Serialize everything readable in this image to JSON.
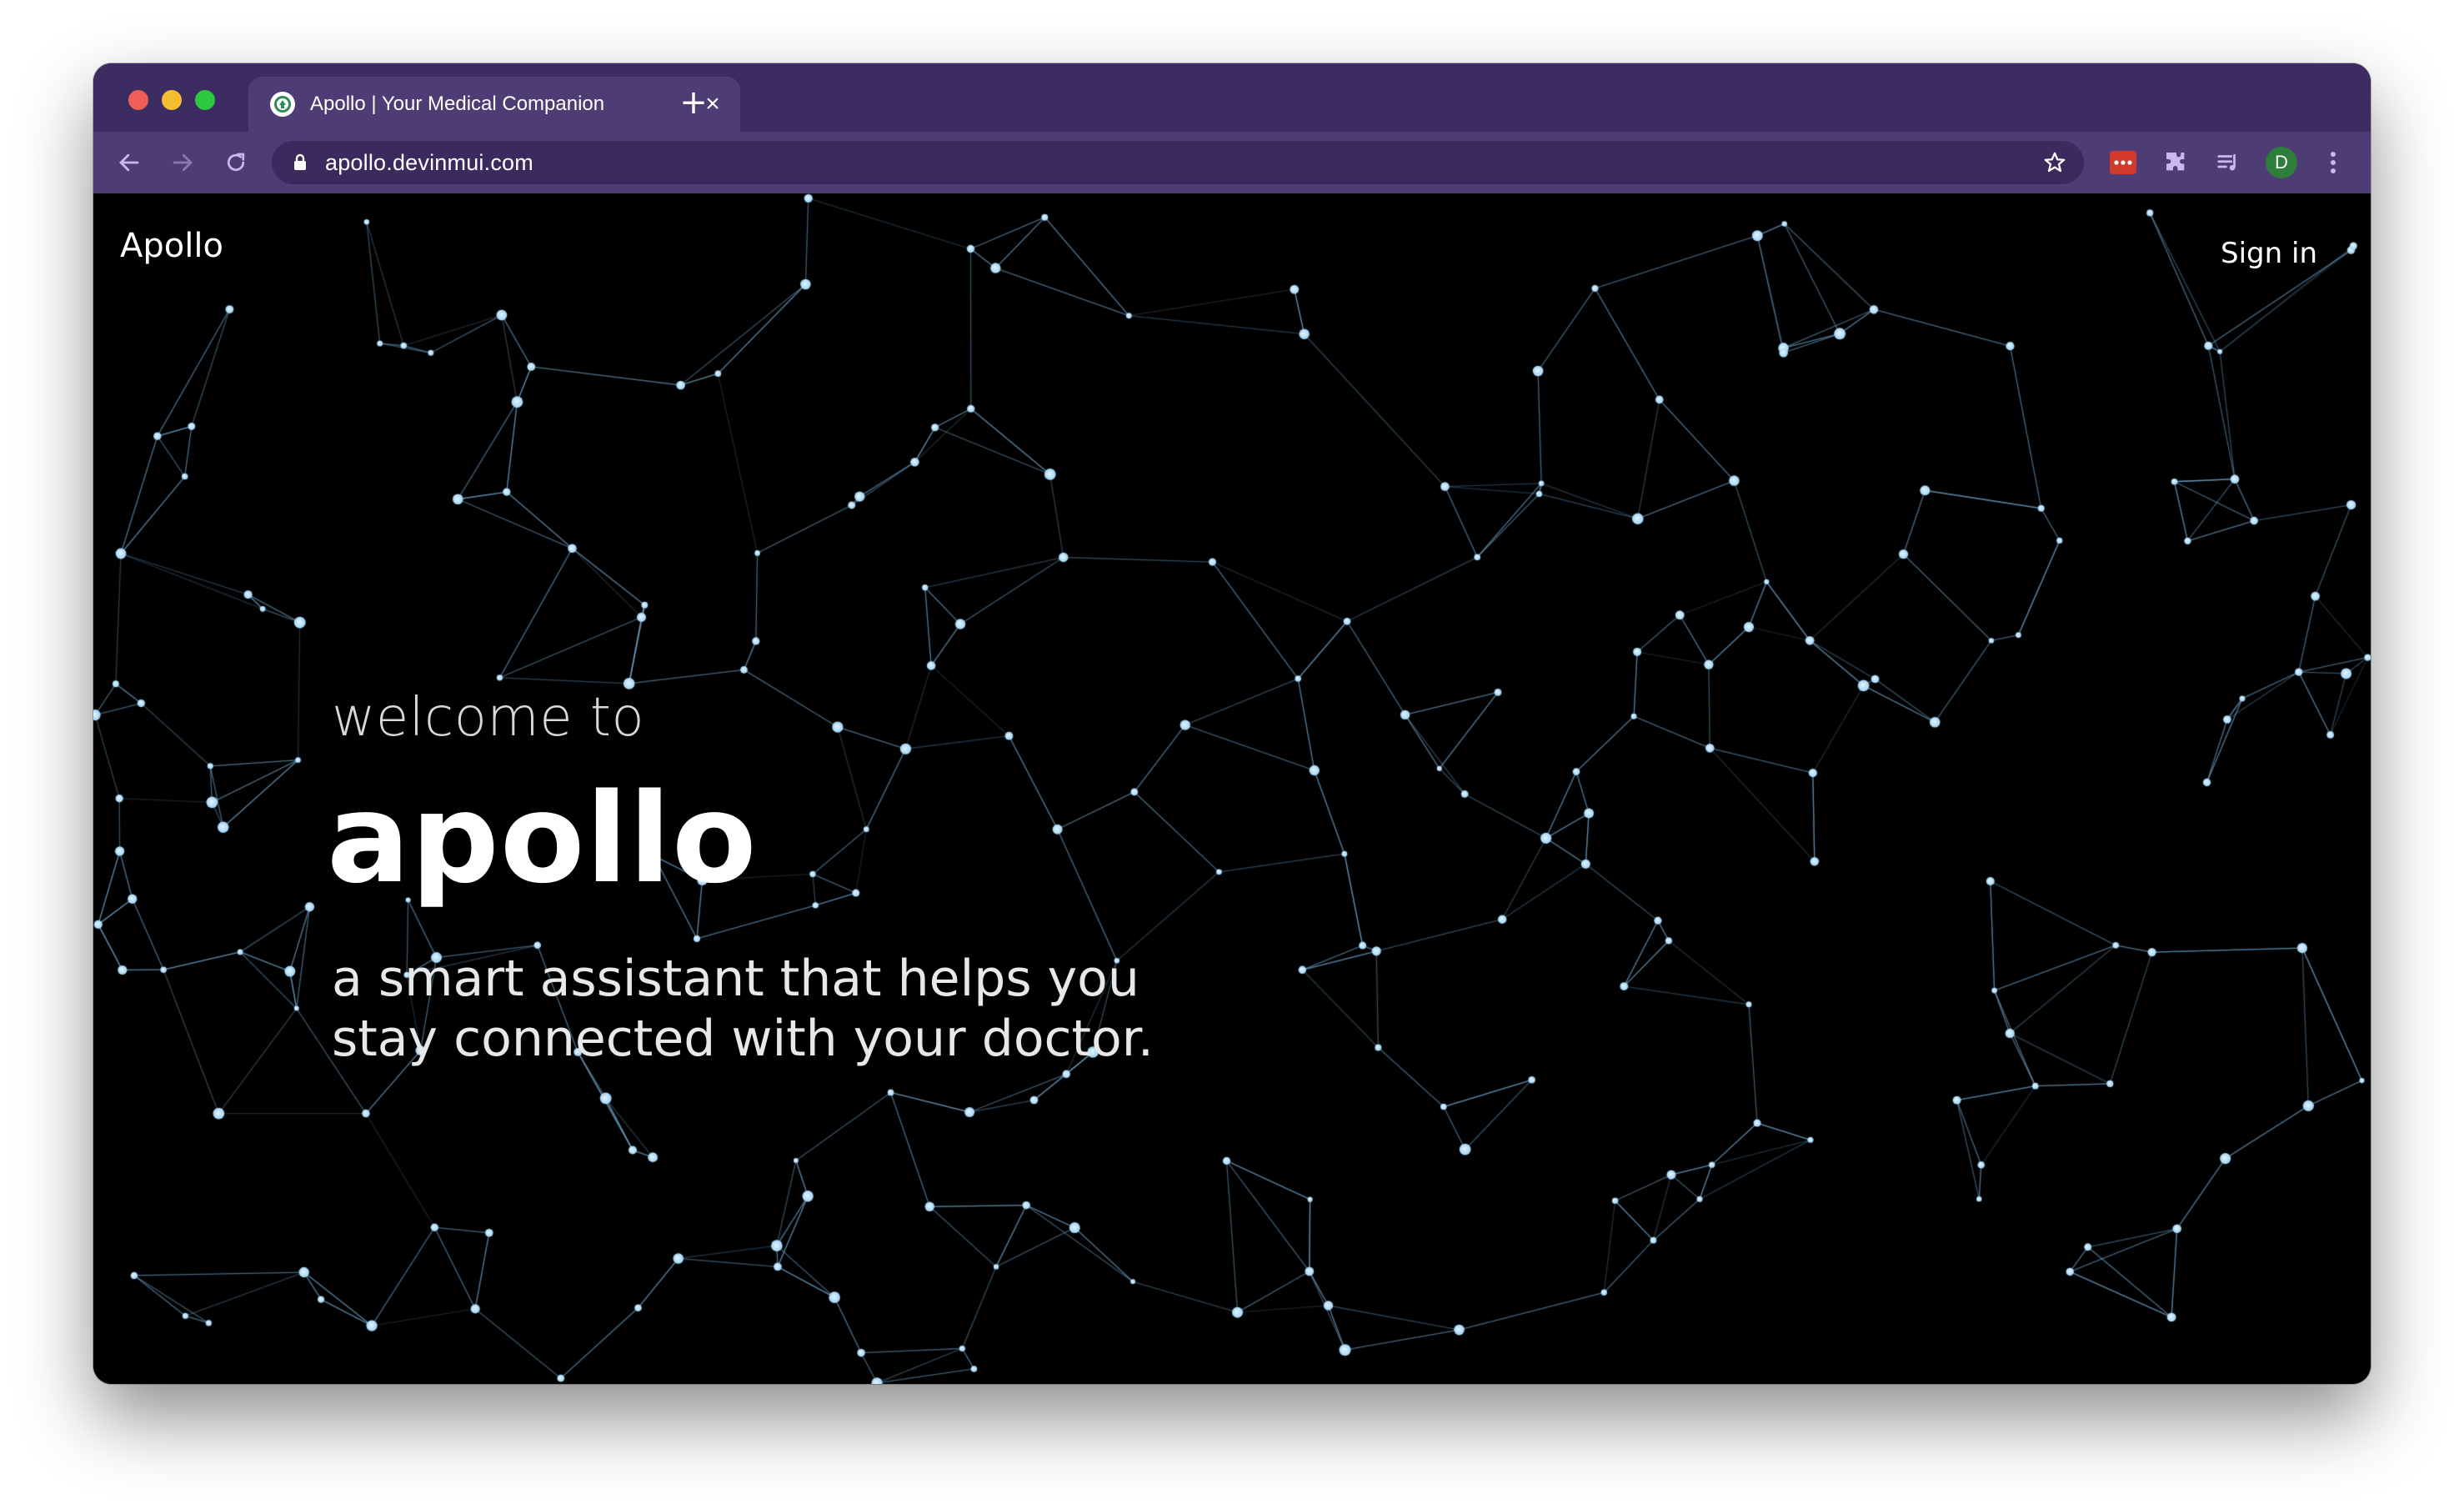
{
  "browser": {
    "tab": {
      "title": "Apollo | Your Medical Companion",
      "close_icon": "close-icon",
      "favicon": "apollo-favicon-icon"
    },
    "new_tab_label": "+",
    "address_bar": {
      "url": "apollo.devinmui.com"
    },
    "profile_initial": "D",
    "colors": {
      "chrome": "#3d2c61",
      "toolbar": "#4e3d75",
      "profile": "#2f7d3b"
    }
  },
  "site": {
    "brand": "Apollo",
    "signin_label": "Sign in",
    "hero": {
      "eyebrow": "welcome to",
      "title": "apollo",
      "subtitle_line1": "a smart assistant that helps you",
      "subtitle_line2": "stay connected with your doctor."
    },
    "colors": {
      "background": "#000000",
      "node": "#9fd3f5",
      "link": "#5b8db4"
    }
  }
}
